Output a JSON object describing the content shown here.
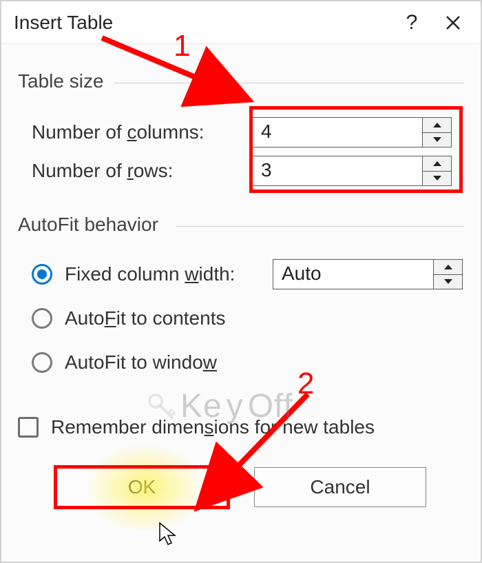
{
  "title": "Insert Table",
  "group_table_size": "Table size",
  "group_autofit": "AutoFit behavior",
  "labels": {
    "num_columns_pre": "Number of ",
    "num_columns_u": "c",
    "num_columns_post": "olumns:",
    "num_rows_pre": "Number of ",
    "num_rows_u": "r",
    "num_rows_post": "ows:",
    "fixed_pre": "Fixed column ",
    "fixed_u": "w",
    "fixed_post": "idth:",
    "autofit_contents_pre": "Auto",
    "autofit_contents_u": "F",
    "autofit_contents_post": "it to contents",
    "autofit_window_pre": "AutoFit to windo",
    "autofit_window_u": "w",
    "autofit_window_post": "",
    "remember_pre": "Remember dimen",
    "remember_u": "s",
    "remember_post": "ions for new tables"
  },
  "values": {
    "columns": "4",
    "rows": "3",
    "fixed_width": "Auto"
  },
  "buttons": {
    "ok": "OK",
    "cancel": "Cancel"
  },
  "annotations": {
    "n1": "1",
    "n2": "2",
    "watermark_left": "Ke",
    "watermark_right": "Off",
    "watermark_mid": "y"
  }
}
